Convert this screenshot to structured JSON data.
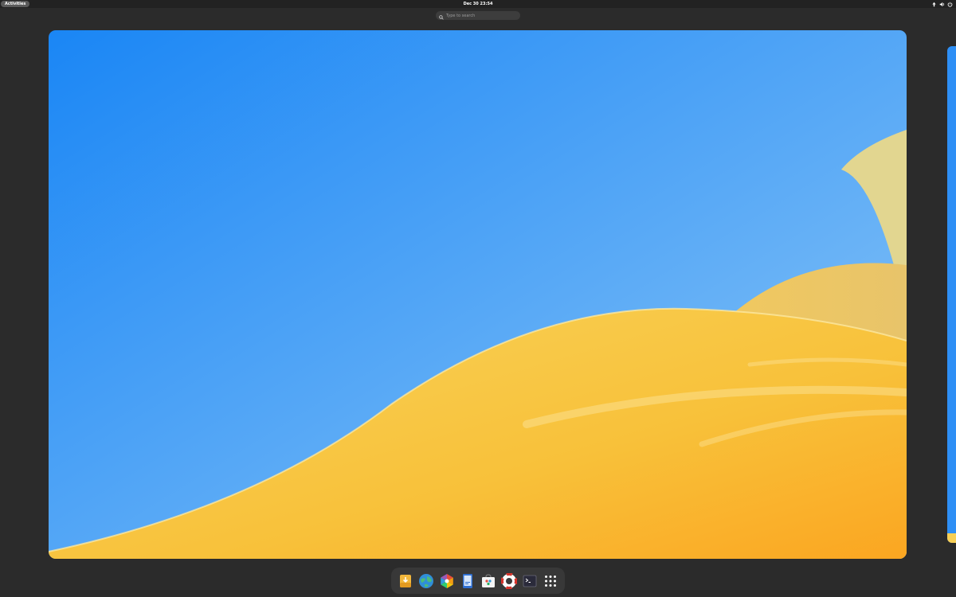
{
  "topbar": {
    "activities_label": "Activities",
    "clock": "Dec 30  23:54",
    "tray": [
      {
        "icon": "network-icon"
      },
      {
        "icon": "volume-icon"
      },
      {
        "icon": "power-icon"
      }
    ]
  },
  "search": {
    "placeholder": "Type to search"
  },
  "colors": {
    "panel": "#222222",
    "background": "#2b2b2b",
    "sky_top": "#1a86f5",
    "sky_bottom": "#7fbff5",
    "dune_yellow": "#f7c948",
    "dune_orange": "#fbae2c",
    "dock": "#383838"
  },
  "dock": {
    "items": [
      {
        "icon": "software-installer-icon"
      },
      {
        "icon": "web-browser-icon"
      },
      {
        "icon": "color-palette-icon"
      },
      {
        "icon": "document-viewer-icon"
      },
      {
        "icon": "software-store-icon"
      },
      {
        "icon": "help-lifebuoy-icon"
      },
      {
        "icon": "terminal-icon"
      },
      {
        "icon": "app-grid-icon"
      }
    ]
  }
}
